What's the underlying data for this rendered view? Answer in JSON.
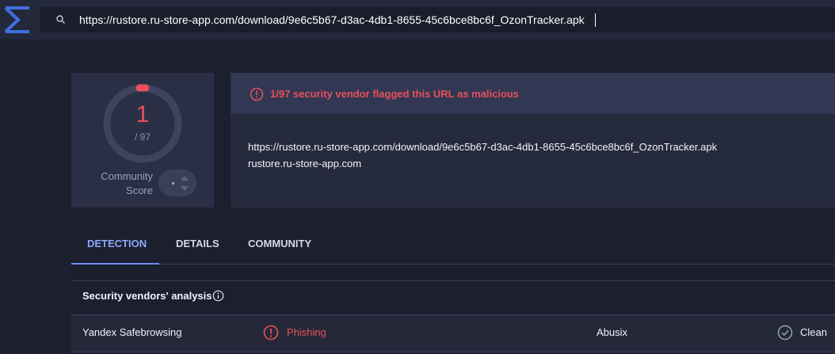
{
  "search": {
    "value": "https://rustore.ru-store-app.com/download/9e6c5b67-d3ac-4db1-8655-45c6bce8bc6f_OzonTracker.apk"
  },
  "score": {
    "detections": "1",
    "total": "/ 97",
    "detection_fraction": 0.0103,
    "community_label_line1": "Community",
    "community_label_line2": "Score"
  },
  "alert": {
    "text": "1/97 security vendor flagged this URL as malicious"
  },
  "details": {
    "url": "https://rustore.ru-store-app.com/download/9e6c5b67-d3ac-4db1-8655-45c6bce8bc6f_OzonTracker.apk",
    "domain": "rustore.ru-store-app.com"
  },
  "tabs": [
    {
      "label": "DETECTION",
      "active": true
    },
    {
      "label": "DETAILS",
      "active": false
    },
    {
      "label": "COMMUNITY",
      "active": false
    }
  ],
  "analysis": {
    "title": "Security vendors' analysis",
    "rows": [
      {
        "vendor_a": "Yandex Safebrowsing",
        "result_a": "Phishing",
        "vendor_b": "Abusix",
        "result_b": "Clean"
      }
    ]
  },
  "colors": {
    "malicious": "#e8505b",
    "accent": "#6d8bff",
    "clean": "#8fa8a0"
  },
  "icons": [
    "logo-icon",
    "search-icon",
    "alert-icon",
    "info-icon",
    "phishing-icon",
    "clean-check-icon",
    "vote-up-icon",
    "vote-down-icon"
  ]
}
